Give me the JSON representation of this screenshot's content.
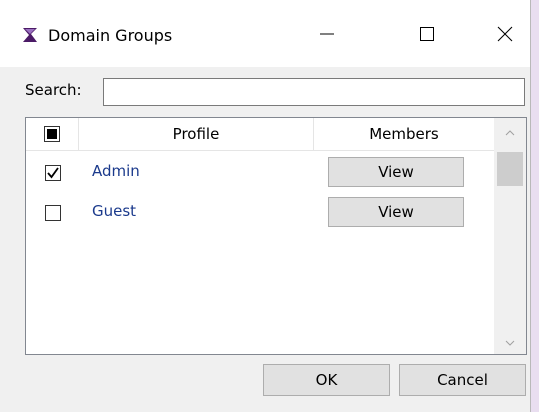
{
  "window": {
    "title": "Domain Groups",
    "icons": {
      "app": "app-logo-icon",
      "minimize": "minimize-icon",
      "maximize": "maximize-icon",
      "close": "close-icon"
    }
  },
  "search": {
    "label": "Search:",
    "value": "",
    "placeholder": ""
  },
  "grid": {
    "header": {
      "profile": "Profile",
      "members": "Members",
      "select_all_state": "indeterminate"
    },
    "rows": [
      {
        "checked": true,
        "profile": "Admin",
        "action": "View"
      },
      {
        "checked": false,
        "profile": "Guest",
        "action": "View"
      }
    ]
  },
  "buttons": {
    "ok": "OK",
    "cancel": "Cancel"
  },
  "colors": {
    "link": "#1b3a8c",
    "button_face": "#e1e1e1",
    "client_bg": "#f0f0f0",
    "icon_purple": "#4b1a66"
  }
}
